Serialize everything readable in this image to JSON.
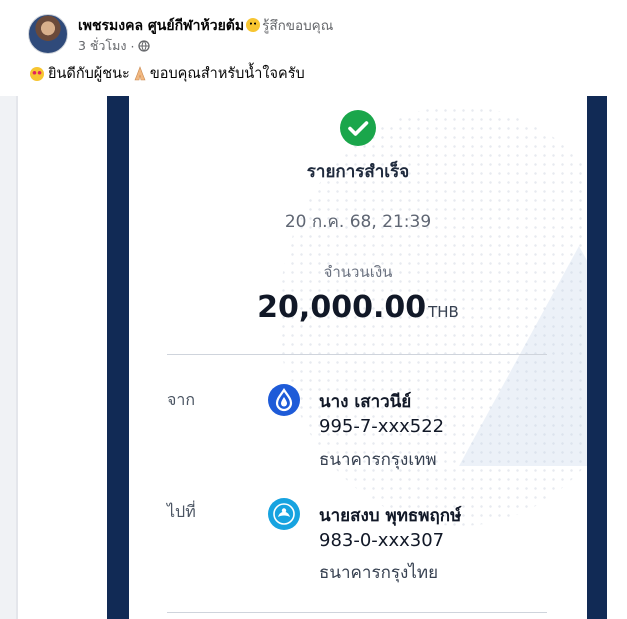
{
  "post": {
    "author": "เพชรมงคล ศูนย์กีฬาห้วยต้ม",
    "feeling": "รู้สึกขอบคุณ",
    "time": "3 ชั่วโมง",
    "time_separator": "·",
    "caption_part1": "ยินดีกับผู้ชนะ",
    "caption_part2": "ขอบคุณสำหรับน้ำใจครับ"
  },
  "slip": {
    "status": "รายการสำเร็จ",
    "datetime": "20 ก.ค. 68, 21:39",
    "amount_label": "จำนวนเงิน",
    "amount": "20,000.00",
    "currency": "THB",
    "from": {
      "label": "จาก",
      "name": "นาง เสาวนีย์",
      "account": "995-7-xxx522",
      "bank": "ธนาคารกรุงเทพ",
      "icon": "bangkok-bank-icon",
      "color": "#1e5bd8"
    },
    "to": {
      "label": "ไปที่",
      "name": "นายสงบ พุทธพฤกษ์",
      "account": "983-0-xxx307",
      "bank": "ธนาคารกรุงไทย",
      "icon": "krungthai-bank-icon",
      "color": "#17a3e0"
    },
    "border_color": "#112a55",
    "success_color": "#1aa64b"
  }
}
